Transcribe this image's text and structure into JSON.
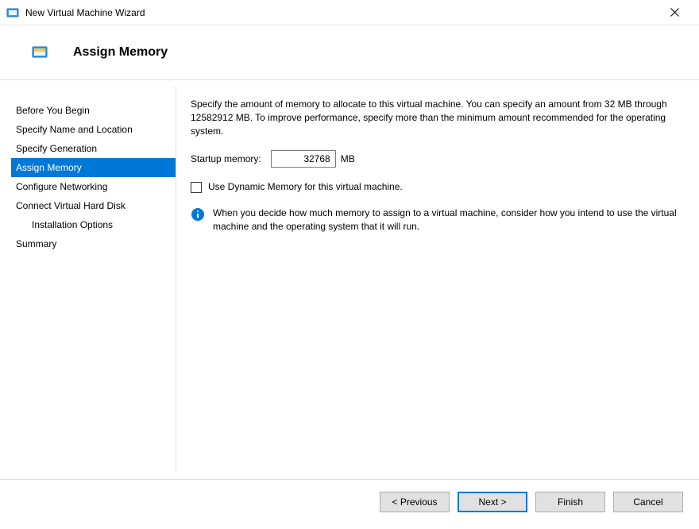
{
  "window": {
    "title": "New Virtual Machine Wizard"
  },
  "header": {
    "title": "Assign Memory"
  },
  "sidebar": {
    "items": [
      {
        "label": "Before You Begin",
        "selected": false,
        "indent": false
      },
      {
        "label": "Specify Name and Location",
        "selected": false,
        "indent": false
      },
      {
        "label": "Specify Generation",
        "selected": false,
        "indent": false
      },
      {
        "label": "Assign Memory",
        "selected": true,
        "indent": false
      },
      {
        "label": "Configure Networking",
        "selected": false,
        "indent": false
      },
      {
        "label": "Connect Virtual Hard Disk",
        "selected": false,
        "indent": false
      },
      {
        "label": "Installation Options",
        "selected": false,
        "indent": true
      },
      {
        "label": "Summary",
        "selected": false,
        "indent": false
      }
    ]
  },
  "content": {
    "description": "Specify the amount of memory to allocate to this virtual machine. You can specify an amount from 32 MB through 12582912 MB. To improve performance, specify more than the minimum amount recommended for the operating system.",
    "startup_memory_label": "Startup memory:",
    "startup_memory_value": "32768",
    "startup_memory_unit": "MB",
    "dynamic_memory_label": "Use Dynamic Memory for this virtual machine.",
    "dynamic_memory_checked": false,
    "info_text": "When you decide how much memory to assign to a virtual machine, consider how you intend to use the virtual machine and the operating system that it will run."
  },
  "footer": {
    "previous": "< Previous",
    "next": "Next >",
    "finish": "Finish",
    "cancel": "Cancel"
  }
}
